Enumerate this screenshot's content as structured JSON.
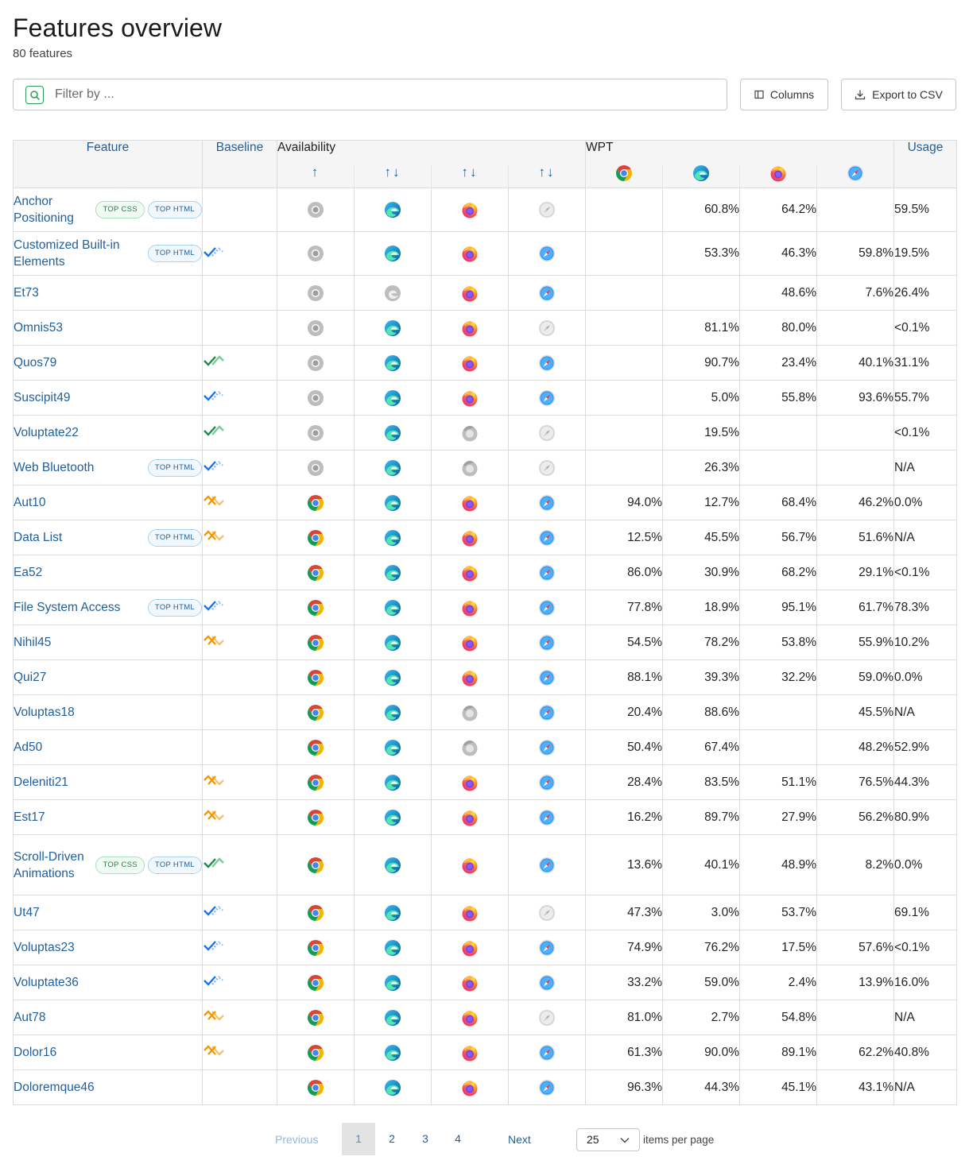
{
  "header": {
    "title": "Features overview",
    "subtitle": "80 features"
  },
  "toolbar": {
    "filter_placeholder": "Filter by ...",
    "columns_label": "Columns",
    "export_label": "Export to CSV"
  },
  "table": {
    "headers": {
      "feature": "Feature",
      "baseline": "Baseline",
      "availability": "Availability",
      "wpt": "WPT",
      "usage": "Usage"
    },
    "availability_sort": [
      "↑",
      "↑↓",
      "↑↓",
      "↑↓"
    ],
    "browsers": [
      "chrome",
      "edge",
      "firefox",
      "safari"
    ],
    "rows": [
      {
        "name": "Anchor Positioning",
        "badges": [
          "TOP CSS",
          "TOP HTML"
        ],
        "baseline": "",
        "avail": [
          0,
          1,
          1,
          0
        ],
        "wpt": [
          "",
          "60.8%",
          "64.2%",
          ""
        ],
        "usage": "59.5%"
      },
      {
        "name": "Customized Built-in Elements",
        "badges": [
          "TOP HTML"
        ],
        "baseline": "newly",
        "avail": [
          0,
          1,
          1,
          1
        ],
        "wpt": [
          "",
          "53.3%",
          "46.3%",
          "59.8%"
        ],
        "usage": "19.5%"
      },
      {
        "name": "Et73",
        "badges": [],
        "baseline": "",
        "avail": [
          0,
          0,
          1,
          1
        ],
        "wpt": [
          "",
          "",
          "48.6%",
          "7.6%"
        ],
        "usage": "26.4%"
      },
      {
        "name": "Omnis53",
        "badges": [],
        "baseline": "",
        "avail": [
          0,
          1,
          1,
          0
        ],
        "wpt": [
          "",
          "81.1%",
          "80.0%",
          ""
        ],
        "usage": "<0.1%"
      },
      {
        "name": "Quos79",
        "badges": [],
        "baseline": "widely",
        "avail": [
          0,
          1,
          1,
          1
        ],
        "wpt": [
          "",
          "90.7%",
          "23.4%",
          "40.1%"
        ],
        "usage": "31.1%"
      },
      {
        "name": "Suscipit49",
        "badges": [],
        "baseline": "newly",
        "avail": [
          0,
          1,
          1,
          1
        ],
        "wpt": [
          "",
          "5.0%",
          "55.8%",
          "93.6%"
        ],
        "usage": "55.7%"
      },
      {
        "name": "Voluptate22",
        "badges": [],
        "baseline": "widely",
        "avail": [
          0,
          1,
          0,
          0
        ],
        "wpt": [
          "",
          "19.5%",
          "",
          ""
        ],
        "usage": "<0.1%"
      },
      {
        "name": "Web Bluetooth",
        "badges": [
          "TOP HTML"
        ],
        "baseline": "newly",
        "avail": [
          0,
          1,
          0,
          0
        ],
        "wpt": [
          "",
          "26.3%",
          "",
          ""
        ],
        "usage": "N/A"
      },
      {
        "name": "Aut10",
        "badges": [],
        "baseline": "limited",
        "avail": [
          1,
          1,
          1,
          1
        ],
        "wpt": [
          "94.0%",
          "12.7%",
          "68.4%",
          "46.2%"
        ],
        "usage": "0.0%"
      },
      {
        "name": "Data List",
        "badges": [
          "TOP HTML"
        ],
        "baseline": "limited",
        "avail": [
          1,
          1,
          1,
          1
        ],
        "wpt": [
          "12.5%",
          "45.5%",
          "56.7%",
          "51.6%"
        ],
        "usage": "N/A"
      },
      {
        "name": "Ea52",
        "badges": [],
        "baseline": "",
        "avail": [
          1,
          1,
          1,
          1
        ],
        "wpt": [
          "86.0%",
          "30.9%",
          "68.2%",
          "29.1%"
        ],
        "usage": "<0.1%"
      },
      {
        "name": "File System Access",
        "badges": [
          "TOP HTML"
        ],
        "baseline": "newly",
        "avail": [
          1,
          1,
          1,
          1
        ],
        "wpt": [
          "77.8%",
          "18.9%",
          "95.1%",
          "61.7%"
        ],
        "usage": "78.3%"
      },
      {
        "name": "Nihil45",
        "badges": [],
        "baseline": "limited",
        "avail": [
          1,
          1,
          1,
          1
        ],
        "wpt": [
          "54.5%",
          "78.2%",
          "53.8%",
          "55.9%"
        ],
        "usage": "10.2%"
      },
      {
        "name": "Qui27",
        "badges": [],
        "baseline": "",
        "avail": [
          1,
          1,
          1,
          1
        ],
        "wpt": [
          "88.1%",
          "39.3%",
          "32.2%",
          "59.0%"
        ],
        "usage": "0.0%"
      },
      {
        "name": "Voluptas18",
        "badges": [],
        "baseline": "",
        "avail": [
          1,
          1,
          0,
          1
        ],
        "wpt": [
          "20.4%",
          "88.6%",
          "",
          "45.5%"
        ],
        "usage": "N/A"
      },
      {
        "name": "Ad50",
        "badges": [],
        "baseline": "",
        "avail": [
          1,
          1,
          0,
          1
        ],
        "wpt": [
          "50.4%",
          "67.4%",
          "",
          "48.2%"
        ],
        "usage": "52.9%"
      },
      {
        "name": "Deleniti21",
        "badges": [],
        "baseline": "limited",
        "avail": [
          1,
          1,
          1,
          1
        ],
        "wpt": [
          "28.4%",
          "83.5%",
          "51.1%",
          "76.5%"
        ],
        "usage": "44.3%"
      },
      {
        "name": "Est17",
        "badges": [],
        "baseline": "limited",
        "avail": [
          1,
          1,
          1,
          1
        ],
        "wpt": [
          "16.2%",
          "89.7%",
          "27.9%",
          "56.2%"
        ],
        "usage": "80.9%"
      },
      {
        "name": "Scroll-Driven Animations",
        "badges": [
          "TOP CSS",
          "TOP HTML"
        ],
        "baseline": "widely",
        "avail": [
          1,
          1,
          1,
          1
        ],
        "wpt": [
          "13.6%",
          "40.1%",
          "48.9%",
          "8.2%"
        ],
        "usage": "0.0%"
      },
      {
        "name": "Ut47",
        "badges": [],
        "baseline": "newly",
        "avail": [
          1,
          1,
          1,
          0
        ],
        "wpt": [
          "47.3%",
          "3.0%",
          "53.7%",
          ""
        ],
        "usage": "69.1%"
      },
      {
        "name": "Voluptas23",
        "badges": [],
        "baseline": "newly",
        "avail": [
          1,
          1,
          1,
          1
        ],
        "wpt": [
          "74.9%",
          "76.2%",
          "17.5%",
          "57.6%"
        ],
        "usage": "<0.1%"
      },
      {
        "name": "Voluptate36",
        "badges": [],
        "baseline": "newly",
        "avail": [
          1,
          1,
          1,
          1
        ],
        "wpt": [
          "33.2%",
          "59.0%",
          "2.4%",
          "13.9%"
        ],
        "usage": "16.0%"
      },
      {
        "name": "Aut78",
        "badges": [],
        "baseline": "limited",
        "avail": [
          1,
          1,
          1,
          0
        ],
        "wpt": [
          "81.0%",
          "2.7%",
          "54.8%",
          ""
        ],
        "usage": "N/A"
      },
      {
        "name": "Dolor16",
        "badges": [],
        "baseline": "limited",
        "avail": [
          1,
          1,
          1,
          1
        ],
        "wpt": [
          "61.3%",
          "90.0%",
          "89.1%",
          "62.2%"
        ],
        "usage": "40.8%"
      },
      {
        "name": "Doloremque46",
        "badges": [],
        "baseline": "",
        "avail": [
          1,
          1,
          1,
          1
        ],
        "wpt": [
          "96.3%",
          "44.3%",
          "45.1%",
          "43.1%"
        ],
        "usage": "N/A"
      }
    ]
  },
  "pagination": {
    "previous": "Previous",
    "pages": [
      "1",
      "2",
      "3",
      "4"
    ],
    "active_page": "1",
    "next": "Next",
    "per_page": "25",
    "per_page_label": "items per page"
  },
  "colors": {
    "link": "#1f5f9a",
    "baseline_widely": "#1e8a4a",
    "baseline_newly": "#1a73e8",
    "baseline_limited": "#f29900"
  }
}
